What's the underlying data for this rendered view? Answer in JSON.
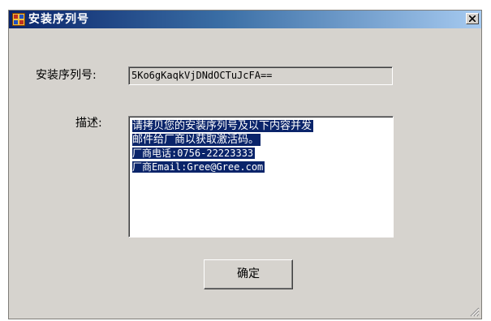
{
  "window": {
    "title": "安装序列号",
    "close_glyph": "×"
  },
  "form": {
    "serial_label": "安装序列号:",
    "serial_value": "5Ko6gKaqkVjDNdOCTuJcFA==",
    "description_label": "描述:",
    "description_lines": [
      "请拷贝您的安装序列号及以下内容并发",
      "邮件给厂商以获取激活码。",
      "厂商电话:0756-22223333",
      "厂商Email:Gree@Gree.com"
    ],
    "ok_label": "确定"
  },
  "colors": {
    "titlebar_start": "#0a246a",
    "titlebar_end": "#a6caf0",
    "selection": "#0a246a",
    "dialog_bg": "#d6d3ce"
  },
  "icons": {
    "app": "application-icon",
    "close": "close-icon",
    "grip": "size-grip-icon"
  }
}
